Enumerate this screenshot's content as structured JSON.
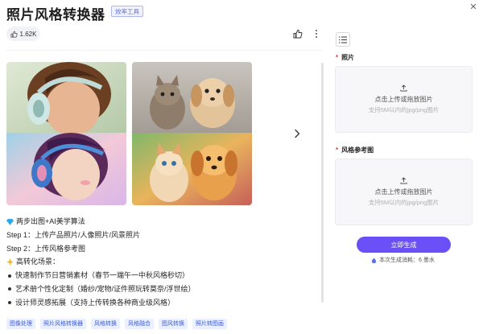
{
  "header": {
    "title": "照片风格转换器",
    "badge": "效率工具",
    "like_count": "1.62K"
  },
  "description": {
    "headline": "两步出图+AI美学算法",
    "step1": "Step 1：上传产品照片/人像照片/风景照片",
    "step2": "Step 2：上传风格参考图",
    "scenes_title": "高转化场景：",
    "bullets": [
      "快速制作节日营销素材（春节一端午一中秋风格秒切）",
      "艺术册个性化定制（婚纱/宠物/证件照玩转莫奈/浮世绘）",
      "设计师灵感拓展（支持上传转换各种商业级风格）"
    ]
  },
  "tags": [
    "图像处理",
    "照片风格转换器",
    "风格转换",
    "风格融合",
    "图风转换",
    "照片转图画"
  ],
  "form": {
    "photo_label": "照片",
    "style_label": "风格参考图",
    "upload_main": "点击上传或拖放图片",
    "upload_hint": "支持5M以内的jpg/png图片",
    "generate_label": "立即生成",
    "cost_text": "本次生成消耗：6 墨水"
  },
  "icons": {
    "like": "thumbs-up-icon",
    "more": "more-vertical-icon",
    "close": "close-icon",
    "next": "chevron-right-icon",
    "menu": "menu-list-icon",
    "upload": "upload-icon",
    "gem": "gem-icon",
    "star": "sparkle-icon",
    "ink": "ink-drop-icon"
  },
  "colors": {
    "accent": "#6a50f6",
    "tag_text": "#3d5ad8",
    "tag_bg": "#eaf0ff",
    "required": "#e53935"
  }
}
